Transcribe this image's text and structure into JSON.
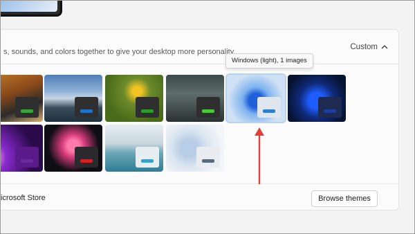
{
  "header": {
    "description": "s, sounds, and colors together to give your desktop more personality",
    "custom_label": "Custom",
    "chevron_icon": "chevron-up-icon"
  },
  "tooltip": {
    "text": "Windows (light), 1 images"
  },
  "themes": [
    {
      "name": "tiger",
      "accent": "#3aa33a",
      "bg": "linear-gradient(160deg,#c07a2a 0%,#8a4a1a 40%,#2a2a2a 70%,#d8b070 100%)"
    },
    {
      "name": "mountain-lake",
      "accent": "#1e73c8",
      "bg": "linear-gradient(180deg,#4f7eb6 0%,#8fb0d6 35%,#c8d6e3 50%,#3a4d5b 70%,#1f3140 100%)"
    },
    {
      "name": "leaf",
      "accent": "#2a9c2a",
      "bg": "radial-gradient(circle at 55% 35%,#f2c423 0 10%,#6d8b2a 30%,#4a6b1a 70%)"
    },
    {
      "name": "forest",
      "accent": "#4ac83a",
      "bg": "linear-gradient(180deg,#3a4a48 0%,#5e6d6c 40%,#2a3331 100%)"
    },
    {
      "name": "windows-light",
      "accent": "#2f7fd1",
      "bg": "radial-gradient(circle at 50% 55%,#1f5fd9 0 18%,#7db3ef 35%,#cfe1f4 70%)"
    },
    {
      "name": "windows-dark",
      "accent": "#1c3fa0",
      "bg": "radial-gradient(circle at 50% 55%,#1e5dff 0 20%,#0f2a7a 45%,#06122f 80%)"
    },
    {
      "name": "glow",
      "accent": "#6a2a9a",
      "bg": "radial-gradient(circle at 10% 70%,#ff9bd8 0 8%,#8a2ad0 25%,#2a0a4a 70%)"
    },
    {
      "name": "flower",
      "accent": "#d42020",
      "bg": "radial-gradient(circle at 50% 45%,#ff7aa8 0 15%,#d43a7a 30%,#0e0e14 65%)"
    },
    {
      "name": "beach",
      "accent": "#3aa0c8",
      "bg": "linear-gradient(180deg,#e6edf1 0%,#c9d7de 40%,#6ca7b8 60%,#2f7d93 100%)"
    },
    {
      "name": "swirl",
      "accent": "#5a6a7a",
      "bg": "radial-gradient(circle at 40% 50%,#b8cde6 0 20%,#dbe6f1 45%,#f3f5f8 80%)"
    }
  ],
  "footer": {
    "text": "icrosoft Store",
    "browse_label": "Browse themes"
  }
}
